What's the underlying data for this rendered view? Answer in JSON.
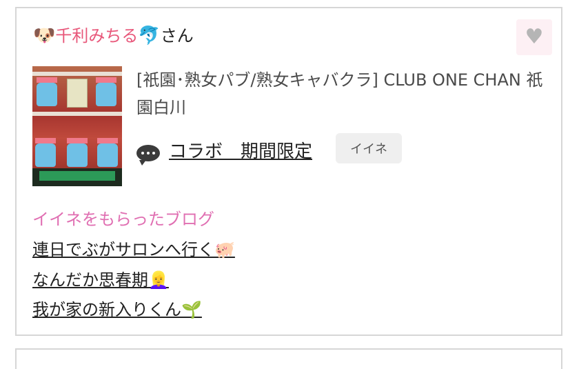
{
  "user": {
    "leading_emoji": "🐶",
    "name": "千利みちる",
    "trailing_emoji": "🐬",
    "honorific": "さん"
  },
  "favorite": {
    "icon": "heart-icon",
    "color": "#b5b5b5"
  },
  "shop": {
    "name": "[祇園･熟女パブ/熟女キャバクラ]  CLUB ONE CHAN 祇園白川"
  },
  "post": {
    "icon": "speech-bubble-icon",
    "title": "コラボ　期間限定",
    "badge": "イイネ"
  },
  "blogs": {
    "label": "イイネをもらったブログ",
    "items": [
      {
        "text": "連日でぶがサロンへ行く",
        "emoji": "🐖"
      },
      {
        "text": "なんだか思春期",
        "emoji": "👱‍♀️"
      },
      {
        "text": "我が家の新入りくん",
        "emoji": "🌱"
      }
    ]
  },
  "colors": {
    "user_name": "#e8577a",
    "section_label": "#e06fb2",
    "card_border": "#d6d6d6"
  }
}
